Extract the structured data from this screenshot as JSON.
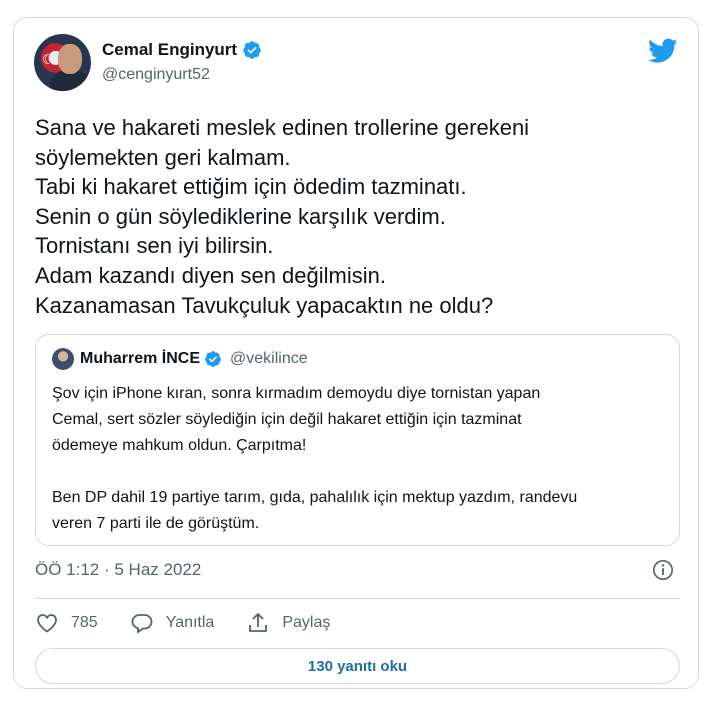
{
  "author": {
    "name": "Cemal Enginyurt",
    "handle": "@cenginyurt52",
    "verified": true
  },
  "tweet": {
    "lines": [
      "Sana ve hakareti meslek edinen trollerine gerekeni",
      "söylemekten geri kalmam.",
      "Tabi ki hakaret ettiğim için ödedim tazminatı.",
      "Senin o gün söylediklerine karşılık verdim.",
      "Tornistanı sen iyi bilirsin.",
      "Adam kazandı diyen sen değilmisin.",
      "Kazanamasan Tavukçuluk yapacaktın ne oldu?"
    ]
  },
  "quote": {
    "name": "Muharrem İNCE",
    "handle": "@vekilince",
    "verified": true,
    "paragraph1": [
      "Şov için iPhone kıran, sonra kırmadım demoydu diye tornistan yapan",
      "Cemal, sert sözler söylediğin için değil hakaret ettiğin için tazminat",
      "ödemeye mahkum oldun. Çarpıtma!"
    ],
    "paragraph2": [
      "Ben DP dahil 19 partiye tarım, gıda, pahalılık için mektup yazdım, randevu",
      "veren 7 parti ile de görüştüm."
    ]
  },
  "meta": {
    "timestamp": "ÖÖ 1:12 · 5 Haz 2022"
  },
  "actions": {
    "like_count": "785",
    "reply_label": "Yanıtla",
    "share_label": "Paylaş"
  },
  "replies_button": "130 yanıtı oku",
  "colors": {
    "twitter_blue": "#1d9bf0",
    "link_blue": "#1d6fa5",
    "secondary_text": "#536471",
    "border": "#cfd9de"
  },
  "icons": [
    "twitter-bird-icon",
    "verified-badge-icon",
    "info-icon",
    "heart-icon",
    "reply-bubble-icon",
    "share-icon"
  ]
}
